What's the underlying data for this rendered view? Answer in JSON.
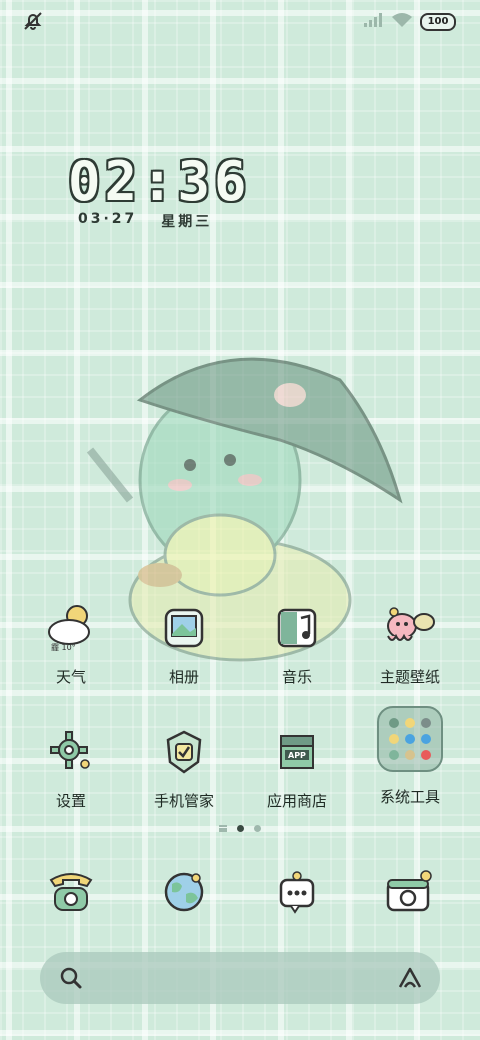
{
  "status": {
    "battery": "100",
    "icons": [
      "notification-muted-icon",
      "signal-bars-icon",
      "wifi-icon",
      "battery-icon"
    ]
  },
  "clock": {
    "time": "02:36",
    "date": "03·27",
    "weekday": "星期三"
  },
  "apps_row1": [
    {
      "name": "weather",
      "label": "天气",
      "icon": "weather-icon",
      "badge": "霾 10°"
    },
    {
      "name": "gallery",
      "label": "相册",
      "icon": "photo-icon"
    },
    {
      "name": "music",
      "label": "音乐",
      "icon": "music-icon"
    },
    {
      "name": "themes",
      "label": "主题壁纸",
      "icon": "theme-octopus-icon"
    }
  ],
  "apps_row2": [
    {
      "name": "settings",
      "label": "设置",
      "icon": "gear-icon"
    },
    {
      "name": "phone-manager",
      "label": "手机管家",
      "icon": "shield-check-icon"
    },
    {
      "name": "app-store",
      "label": "应用商店",
      "icon": "app-store-icon",
      "badge": "APP"
    },
    {
      "name": "system-tools",
      "label": "系统工具",
      "icon": "folder-icon"
    }
  ],
  "dock": [
    {
      "name": "phone",
      "icon": "telephone-icon"
    },
    {
      "name": "browser",
      "icon": "globe-icon"
    },
    {
      "name": "messages",
      "icon": "message-icon"
    },
    {
      "name": "camera",
      "icon": "camera-icon"
    }
  ],
  "pages": {
    "count": 2,
    "active": 1
  },
  "colors": {
    "background": "#cfeadb",
    "grid": "#ffffff",
    "ink": "#2e3b34",
    "search_bar": "#aac8bc"
  }
}
